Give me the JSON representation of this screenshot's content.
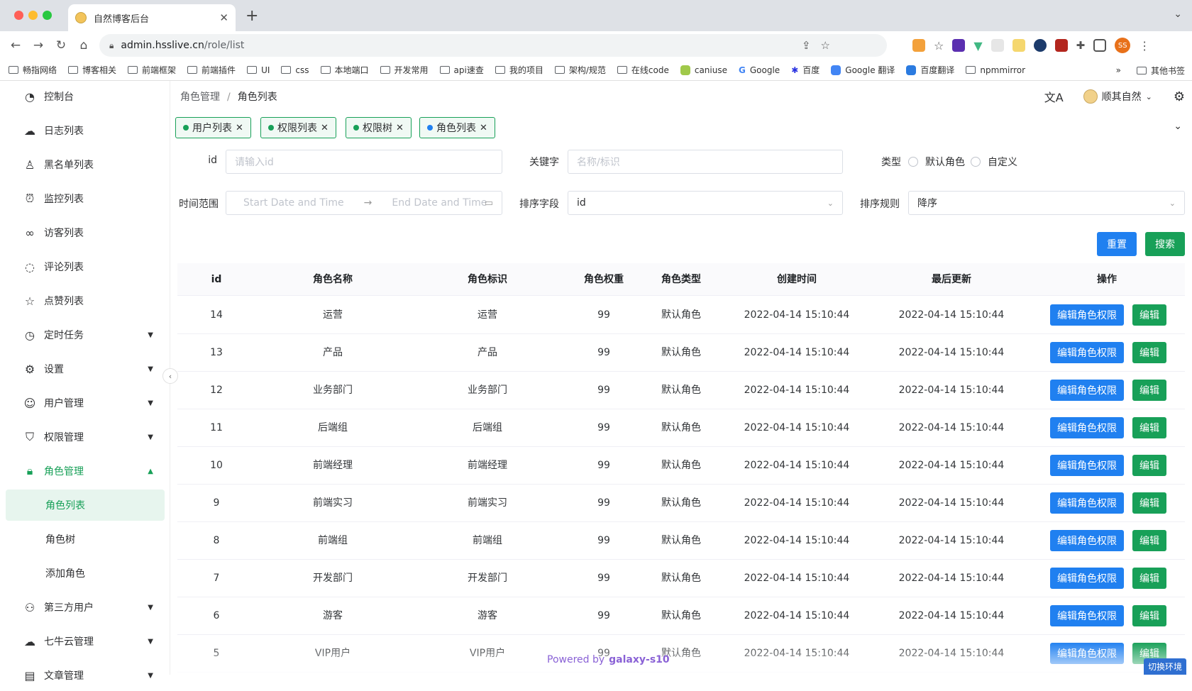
{
  "browser": {
    "tab_title": "自然博客后台",
    "url_host": "admin.hsslive.cn",
    "url_path": "/role/list",
    "bookmarks": [
      "畅指网络",
      "博客相关",
      "前端框架",
      "前端插件",
      "UI",
      "css",
      "本地端口",
      "开发常用",
      "api速查",
      "我的项目",
      "架构/规范",
      "在线code",
      "caniuse",
      "Google",
      "百度",
      "Google 翻译",
      "百度翻译",
      "npmmirror"
    ],
    "bookmarks_more": "»",
    "other_bookmarks": "其他书签",
    "profile_initials": "SS"
  },
  "sidebar": {
    "items": [
      {
        "label": "控制台",
        "icon": "dashboard-icon"
      },
      {
        "label": "日志列表",
        "icon": "cloud-icon"
      },
      {
        "label": "黑名单列表",
        "icon": "person-icon"
      },
      {
        "label": "监控列表",
        "icon": "alarm-icon"
      },
      {
        "label": "访客列表",
        "icon": "footprint-icon"
      },
      {
        "label": "评论列表",
        "icon": "comment-icon"
      },
      {
        "label": "点赞列表",
        "icon": "star-icon"
      },
      {
        "label": "定时任务",
        "icon": "clock-icon"
      },
      {
        "label": "设置",
        "icon": "gear-icon"
      },
      {
        "label": "用户管理",
        "icon": "user-icon"
      },
      {
        "label": "权限管理",
        "icon": "shield-icon"
      },
      {
        "label": "角色管理",
        "icon": "lock-icon"
      },
      {
        "label": "角色列表"
      },
      {
        "label": "角色树"
      },
      {
        "label": "添加角色"
      },
      {
        "label": "第三方用户",
        "icon": "users-icon"
      },
      {
        "label": "七牛云管理",
        "icon": "cloud-upload-icon"
      },
      {
        "label": "文章管理",
        "icon": "article-icon"
      }
    ]
  },
  "header": {
    "breadcrumb_parent": "角色管理",
    "breadcrumb_sep": "/",
    "breadcrumb_current": "角色列表",
    "username": "顺其自然"
  },
  "tags": [
    "用户列表",
    "权限列表",
    "权限树",
    "角色列表"
  ],
  "filters": {
    "id_label": "id",
    "id_placeholder": "请输入id",
    "keyword_label": "关键字",
    "keyword_placeholder": "名称/标识",
    "type_label": "类型",
    "type_options": [
      "默认角色",
      "自定义"
    ],
    "time_label": "时间范围",
    "start_placeholder": "Start Date and Time",
    "end_placeholder": "End Date and Time",
    "sort_field_label": "排序字段",
    "sort_field_value": "id",
    "sort_rule_label": "排序规则",
    "sort_rule_value": "降序",
    "reset_label": "重置",
    "search_label": "搜索"
  },
  "table": {
    "columns": [
      "id",
      "角色名称",
      "角色标识",
      "角色权重",
      "角色类型",
      "创建时间",
      "最后更新",
      "操作"
    ],
    "rows": [
      {
        "id": "14",
        "name": "运营",
        "key": "运营",
        "weight": "99",
        "type": "默认角色",
        "created": "2022-04-14 15:10:44",
        "updated": "2022-04-14 15:10:44"
      },
      {
        "id": "13",
        "name": "产品",
        "key": "产品",
        "weight": "99",
        "type": "默认角色",
        "created": "2022-04-14 15:10:44",
        "updated": "2022-04-14 15:10:44"
      },
      {
        "id": "12",
        "name": "业务部门",
        "key": "业务部门",
        "weight": "99",
        "type": "默认角色",
        "created": "2022-04-14 15:10:44",
        "updated": "2022-04-14 15:10:44"
      },
      {
        "id": "11",
        "name": "后端组",
        "key": "后端组",
        "weight": "99",
        "type": "默认角色",
        "created": "2022-04-14 15:10:44",
        "updated": "2022-04-14 15:10:44"
      },
      {
        "id": "10",
        "name": "前端经理",
        "key": "前端经理",
        "weight": "99",
        "type": "默认角色",
        "created": "2022-04-14 15:10:44",
        "updated": "2022-04-14 15:10:44"
      },
      {
        "id": "9",
        "name": "前端实习",
        "key": "前端实习",
        "weight": "99",
        "type": "默认角色",
        "created": "2022-04-14 15:10:44",
        "updated": "2022-04-14 15:10:44"
      },
      {
        "id": "8",
        "name": "前端组",
        "key": "前端组",
        "weight": "99",
        "type": "默认角色",
        "created": "2022-04-14 15:10:44",
        "updated": "2022-04-14 15:10:44"
      },
      {
        "id": "7",
        "name": "开发部门",
        "key": "开发部门",
        "weight": "99",
        "type": "默认角色",
        "created": "2022-04-14 15:10:44",
        "updated": "2022-04-14 15:10:44"
      },
      {
        "id": "6",
        "name": "游客",
        "key": "游客",
        "weight": "99",
        "type": "默认角色",
        "created": "2022-04-14 15:10:44",
        "updated": "2022-04-14 15:10:44"
      },
      {
        "id": "5",
        "name": "VIP用户",
        "key": "VIP用户",
        "weight": "99",
        "type": "默认角色",
        "created": "2022-04-14 15:10:44",
        "updated": "2022-04-14 15:10:44"
      }
    ],
    "edit_perm_label": "编辑角色权限",
    "edit_label": "编辑"
  },
  "footer": {
    "powered": "Powered by",
    "brand": "galaxy-s10",
    "env_switch": "切换环境"
  },
  "colors": {
    "primary": "#18a058",
    "info": "#2080f0"
  }
}
